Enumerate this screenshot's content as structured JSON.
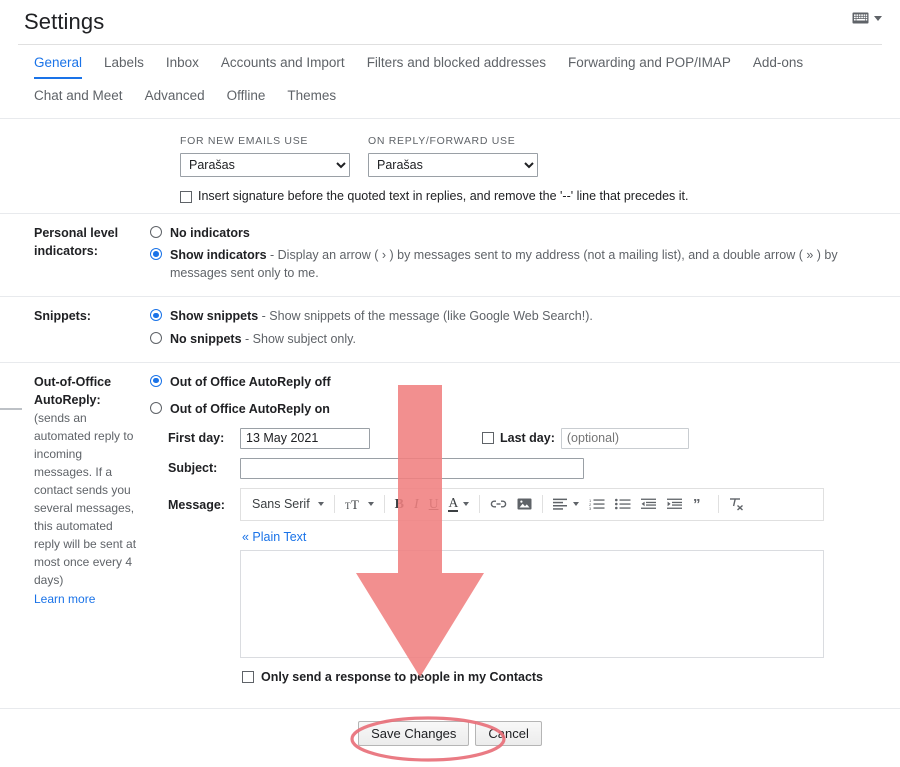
{
  "header": {
    "title": "Settings",
    "keyboard_icon": "keyboard-icon",
    "caret_icon": "chevron-down-icon"
  },
  "tabs": {
    "row1": [
      {
        "label": "General",
        "active": true
      },
      {
        "label": "Labels",
        "active": false
      },
      {
        "label": "Inbox",
        "active": false
      },
      {
        "label": "Accounts and Import",
        "active": false
      },
      {
        "label": "Filters and blocked addresses",
        "active": false
      },
      {
        "label": "Forwarding and POP/IMAP",
        "active": false
      },
      {
        "label": "Add-ons",
        "active": false
      }
    ],
    "row2": [
      {
        "label": "Chat and Meet",
        "active": false
      },
      {
        "label": "Advanced",
        "active": false
      },
      {
        "label": "Offline",
        "active": false
      },
      {
        "label": "Themes",
        "active": false
      }
    ]
  },
  "signature": {
    "new_emails_caption": "FOR NEW EMAILS USE",
    "reply_forward_caption": "ON REPLY/FORWARD USE",
    "new_emails_value": "Parašas",
    "reply_forward_value": "Parašas",
    "insert_before_quoted": "Insert signature before the quoted text in replies, and remove the '--' line that precedes it.",
    "insert_before_quoted_checked": false
  },
  "personal_indicators": {
    "label": "Personal level indicators:",
    "option_none_label": "No indicators",
    "option_none_selected": false,
    "option_show_label": "Show indicators",
    "option_show_desc": " - Display an arrow ( › ) by messages sent to my address (not a mailing list), and a double arrow ( » ) by messages sent only to me.",
    "option_show_selected": true
  },
  "snippets": {
    "label": "Snippets:",
    "option_show_label": "Show snippets",
    "option_show_desc": " - Show snippets of the message (like Google Web Search!).",
    "option_show_selected": true,
    "option_none_label": "No snippets",
    "option_none_desc": " - Show subject only.",
    "option_none_selected": false
  },
  "out_of_office": {
    "label": "Out-of-Office AutoReply:",
    "description": "(sends an automated reply to incoming messages. If a contact sends you several messages, this automated reply will be sent at most once every 4 days)",
    "learn_more": "Learn more",
    "option_off_label": "Out of Office AutoReply off",
    "option_off_selected": true,
    "option_on_label": "Out of Office AutoReply on",
    "option_on_selected": false,
    "first_day_label": "First day:",
    "first_day_value": "13 May 2021",
    "last_day_label": "Last day:",
    "last_day_placeholder": "(optional)",
    "last_day_value": "",
    "last_day_checked": false,
    "subject_label": "Subject:",
    "subject_value": "",
    "message_label": "Message:",
    "message_value": "",
    "plain_text_link": "« Plain Text",
    "only_contacts_label": "Only send a response to people in my Contacts",
    "only_contacts_checked": false
  },
  "editor_toolbar": {
    "font_name": "Sans Serif",
    "items": [
      {
        "icon": "font-family-dropdown",
        "label": "Sans Serif"
      },
      {
        "icon": "text-size-icon",
        "label": "Size"
      },
      {
        "icon": "bold-icon",
        "label": "B"
      },
      {
        "icon": "italic-icon",
        "label": "I"
      },
      {
        "icon": "underline-icon",
        "label": "U"
      },
      {
        "icon": "text-color-icon",
        "label": "A"
      },
      {
        "icon": "link-icon",
        "label": "Link"
      },
      {
        "icon": "insert-image-icon",
        "label": "Image"
      },
      {
        "icon": "align-icon",
        "label": "Align"
      },
      {
        "icon": "numbered-list-icon",
        "label": "Numbered list"
      },
      {
        "icon": "bulleted-list-icon",
        "label": "Bulleted list"
      },
      {
        "icon": "indent-less-icon",
        "label": "Indent less"
      },
      {
        "icon": "indent-more-icon",
        "label": "Indent more"
      },
      {
        "icon": "quote-icon",
        "label": "Quote"
      },
      {
        "icon": "remove-formatting-icon",
        "label": "Remove formatting"
      }
    ]
  },
  "footer": {
    "save_label": "Save Changes",
    "cancel_label": "Cancel"
  },
  "annotations": {
    "arrow": {
      "icon": "down-arrow-annotation",
      "color": "#F08080"
    },
    "ellipse": {
      "icon": "ellipse-highlight-annotation",
      "color": "#E8707A",
      "target": "Save Changes"
    }
  },
  "colors": {
    "accent": "#1a73e8",
    "text": "#202124",
    "muted": "#5f6368",
    "border": "#e8eaed",
    "annotation": "#F08080"
  }
}
